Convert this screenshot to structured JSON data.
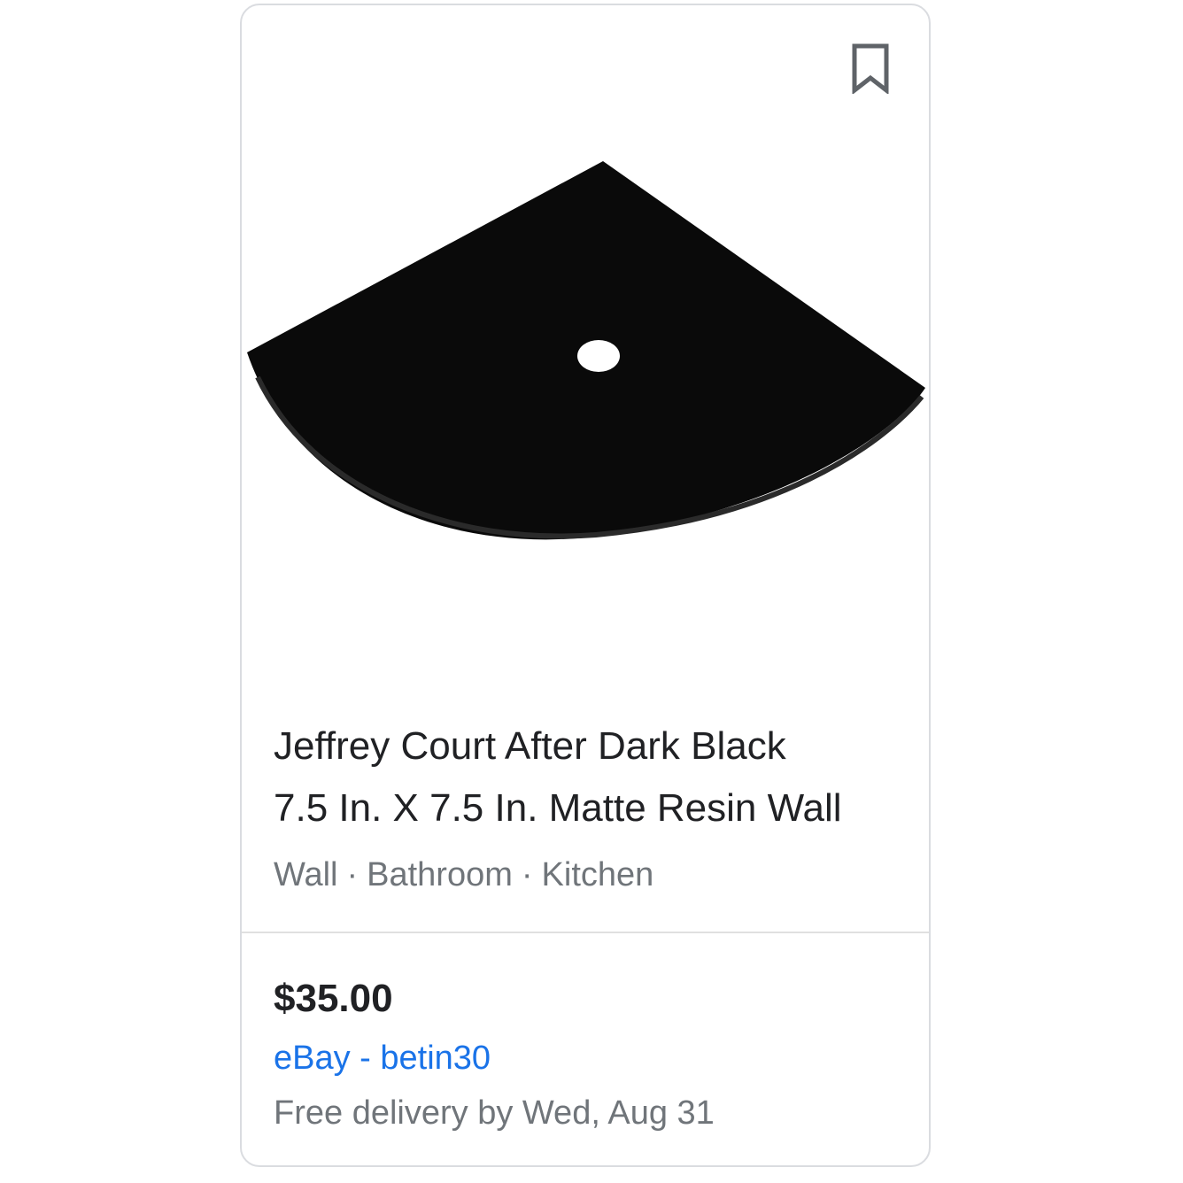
{
  "card": {
    "title_line1": "Jeffrey Court After Dark Black",
    "title_line2": "7.5 In. X 7.5 In. Matte Resin Wall",
    "tags": [
      "Wall",
      "Bathroom",
      "Kitchen"
    ],
    "tag_separator": "·",
    "price": "$35.00",
    "seller": "eBay - betin30",
    "delivery": "Free delivery by Wed, Aug 31",
    "icons": {
      "save": "bookmark-icon"
    },
    "colors": {
      "title": "#202124",
      "meta": "#70757a",
      "link": "#1a73e8",
      "border": "#dadce0",
      "product": "#0a0a0a"
    }
  }
}
